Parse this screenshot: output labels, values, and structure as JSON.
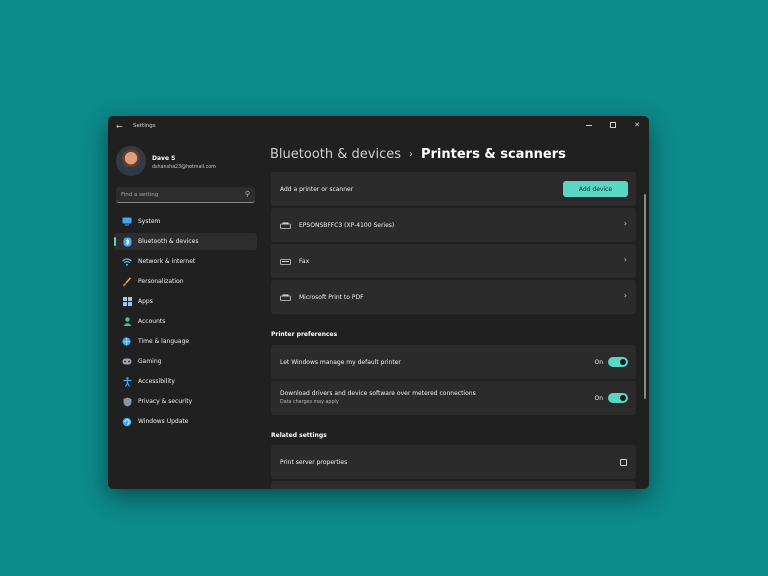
{
  "window": {
    "title": "Settings"
  },
  "profile": {
    "name": "Dave S",
    "email": "dshansha23@hotmail.com"
  },
  "search": {
    "placeholder": "Find a setting"
  },
  "sidebar": {
    "items": [
      {
        "label": "System",
        "icon": "monitor-icon"
      },
      {
        "label": "Bluetooth & devices",
        "icon": "bluetooth-icon",
        "active": true
      },
      {
        "label": "Network & internet",
        "icon": "wifi-icon"
      },
      {
        "label": "Personalization",
        "icon": "brush-icon"
      },
      {
        "label": "Apps",
        "icon": "apps-icon"
      },
      {
        "label": "Accounts",
        "icon": "person-icon"
      },
      {
        "label": "Time & language",
        "icon": "globe-clock-icon"
      },
      {
        "label": "Gaming",
        "icon": "gamepad-icon"
      },
      {
        "label": "Accessibility",
        "icon": "accessibility-icon"
      },
      {
        "label": "Privacy & security",
        "icon": "shield-icon"
      },
      {
        "label": "Windows Update",
        "icon": "update-icon"
      }
    ]
  },
  "breadcrumb": {
    "parent": "Bluetooth & devices",
    "separator": "›",
    "current": "Printers & scanners"
  },
  "add_printer": {
    "label": "Add a printer or scanner",
    "button": "Add device"
  },
  "devices": [
    {
      "name": "EPSONSBFFC3 (XP-4100 Series)",
      "icon": "printer-icon"
    },
    {
      "name": "Fax",
      "icon": "fax-icon"
    },
    {
      "name": "Microsoft Print to PDF",
      "icon": "printer-icon"
    }
  ],
  "printer_preferences": {
    "title": "Printer preferences",
    "items": [
      {
        "label": "Let Windows manage my default printer",
        "state": "On"
      },
      {
        "label": "Download drivers and device software over metered connections",
        "sub": "Data charges may apply",
        "state": "On"
      }
    ]
  },
  "related_settings": {
    "title": "Related settings",
    "items": [
      {
        "label": "Print server properties",
        "icon": "external-link-icon"
      }
    ]
  },
  "colors": {
    "accent": "#5cd6c4",
    "background": "#0d8a8a",
    "window": "#202020",
    "card": "#2b2b2b"
  }
}
